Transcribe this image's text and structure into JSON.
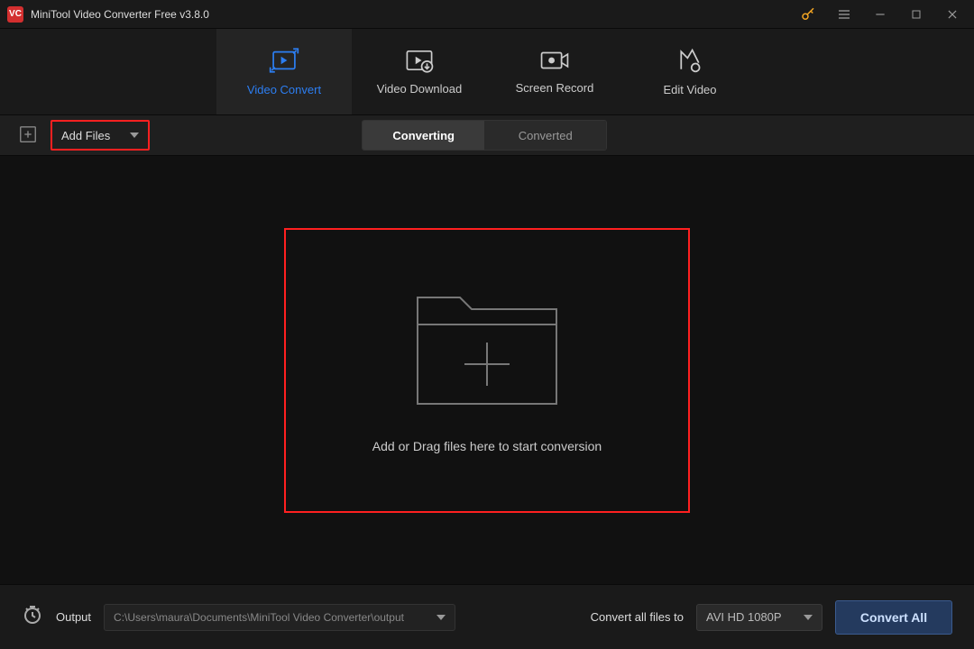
{
  "title": "MiniTool Video Converter Free v3.8.0",
  "nav": {
    "convert": "Video Convert",
    "download": "Video Download",
    "record": "Screen Record",
    "edit": "Edit Video"
  },
  "toolbar": {
    "add_files": "Add Files",
    "converting": "Converting",
    "converted": "Converted"
  },
  "drop": {
    "hint": "Add or Drag files here to start conversion"
  },
  "footer": {
    "output_label": "Output",
    "output_path": "C:\\Users\\maura\\Documents\\MiniTool Video Converter\\output",
    "convert_all_label": "Convert all files to",
    "format": "AVI HD 1080P",
    "convert_all_btn": "Convert All"
  }
}
